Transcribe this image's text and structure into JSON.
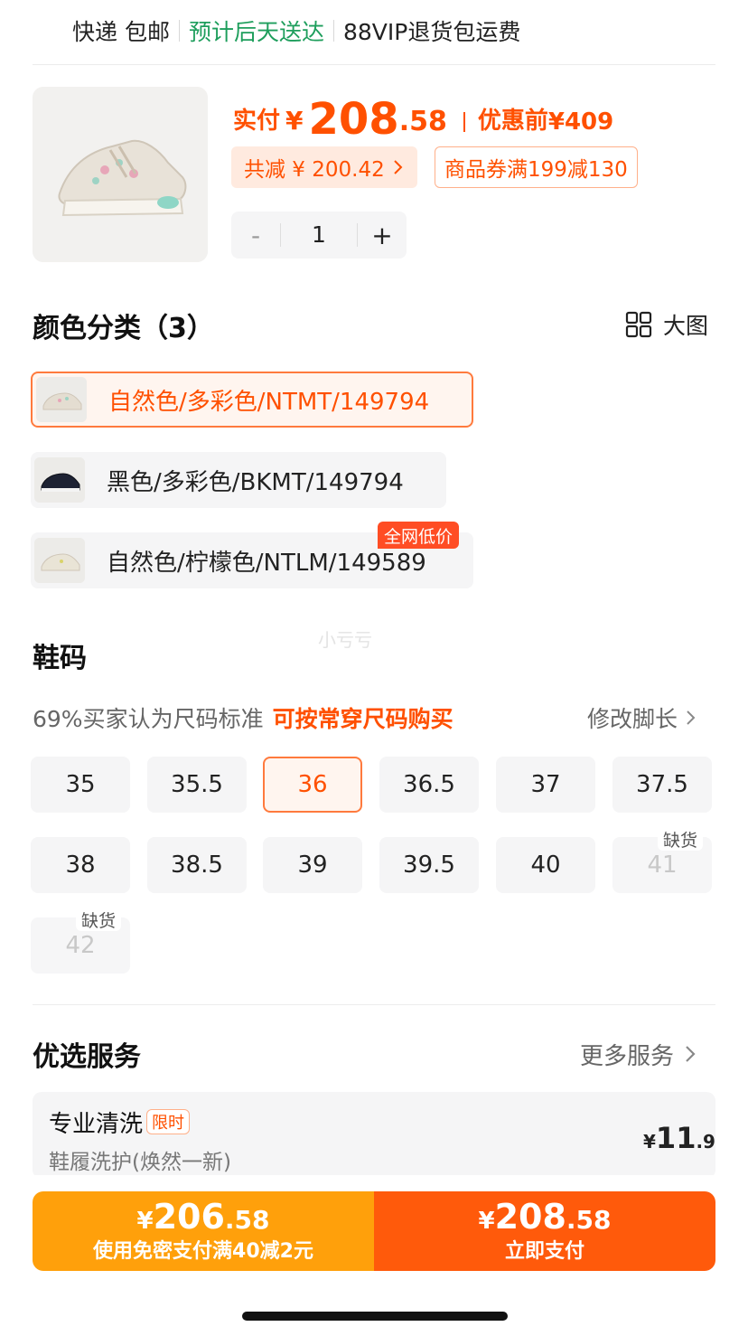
{
  "delivery": {
    "shipping": "快递 包邮",
    "eta": "预计后天送达",
    "return": "88VIP退货包运费"
  },
  "product": {
    "actual_label": "实付",
    "currency": "¥",
    "price_int": "208",
    "price_dec": ".58",
    "original_label": "优惠前",
    "original_price": "¥409",
    "discount_text": "共减 ¥ 200.42",
    "coupon_text": "商品券满199减130",
    "quantity": "1",
    "minus": "-",
    "plus": "+"
  },
  "colors": {
    "title": "颜色分类（3）",
    "big_view": "大图",
    "options": [
      {
        "label": "自然色/多彩色/NTMT/149794",
        "selected": true
      },
      {
        "label": "黑色/多彩色/BKMT/149794",
        "selected": false
      },
      {
        "label": "自然色/柠檬色/NTLM/149589",
        "selected": false,
        "badge": "全网低价"
      }
    ]
  },
  "watermark": "小亏亏",
  "sizes": {
    "title": "鞋码",
    "fit_text": "69%买家认为尺码标准",
    "fit_highlight": "可按常穿尺码购买",
    "edit_foot": "修改脚长",
    "out_of_stock_label": "缺货",
    "items": [
      "35",
      "35.5",
      "36",
      "36.5",
      "37",
      "37.5",
      "38",
      "38.5",
      "39",
      "39.5",
      "40",
      "41",
      "42"
    ],
    "selected": "36",
    "out_of_stock": [
      "41",
      "42"
    ]
  },
  "services": {
    "title": "优选服务",
    "more": "更多服务",
    "item": {
      "name": "专业清洗",
      "tag": "限时",
      "desc": "鞋履洗护(焕然一新)",
      "currency": "¥",
      "price_int": "11",
      "price_dec": ".9"
    }
  },
  "actions": {
    "left": {
      "currency": "¥",
      "int": "206",
      "dec": ".58",
      "label": "使用免密支付满40减2元"
    },
    "right": {
      "currency": "¥",
      "int": "208",
      "dec": ".58",
      "label": "立即支付"
    }
  },
  "colors_theme": {
    "accent": "#ff5000",
    "green": "#1e9e5c",
    "pay_left": "#ffa00b",
    "pay_right": "#ff5a0b"
  }
}
